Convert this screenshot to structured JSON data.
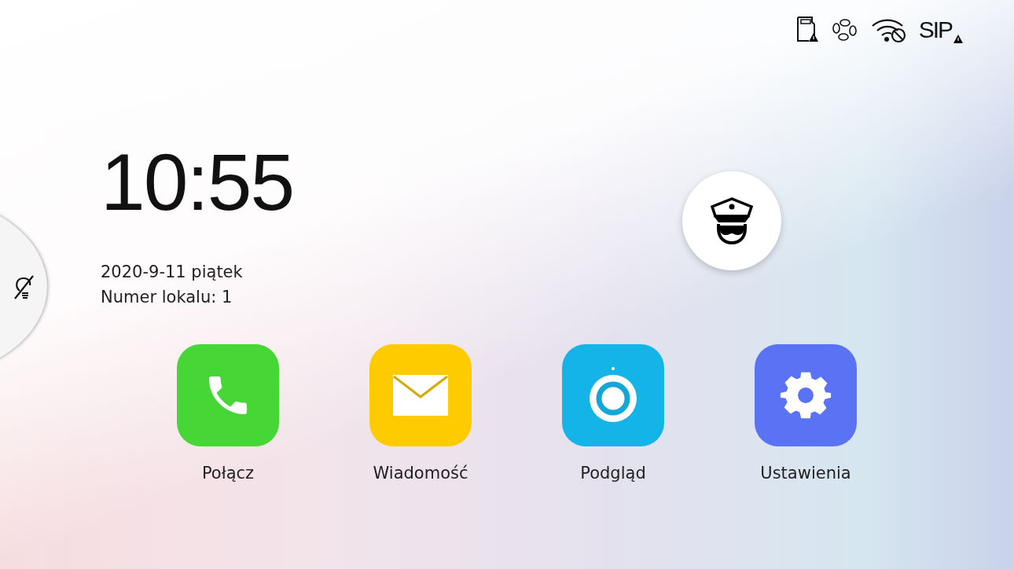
{
  "status_icons": [
    {
      "kind": "sd-card"
    },
    {
      "kind": "network"
    },
    {
      "kind": "wifi"
    },
    {
      "kind": "sip",
      "label": "SIP"
    }
  ],
  "clock": {
    "time": "10:55",
    "date": "2020-9-11 piątek",
    "apartment": "Numer lokalu: 1"
  },
  "side_panel": {
    "kind": "light-off"
  },
  "emergency_button": {
    "kind": "guard"
  },
  "apps": [
    {
      "kind": "call",
      "label": "Połącz",
      "color": "#46d636"
    },
    {
      "kind": "message",
      "label": "Wiadomość",
      "color": "#fecb00"
    },
    {
      "kind": "monitor",
      "label": "Podgląd",
      "color": "#14b4e8"
    },
    {
      "kind": "settings",
      "label": "Ustawienia",
      "color": "#5a73f5"
    }
  ]
}
